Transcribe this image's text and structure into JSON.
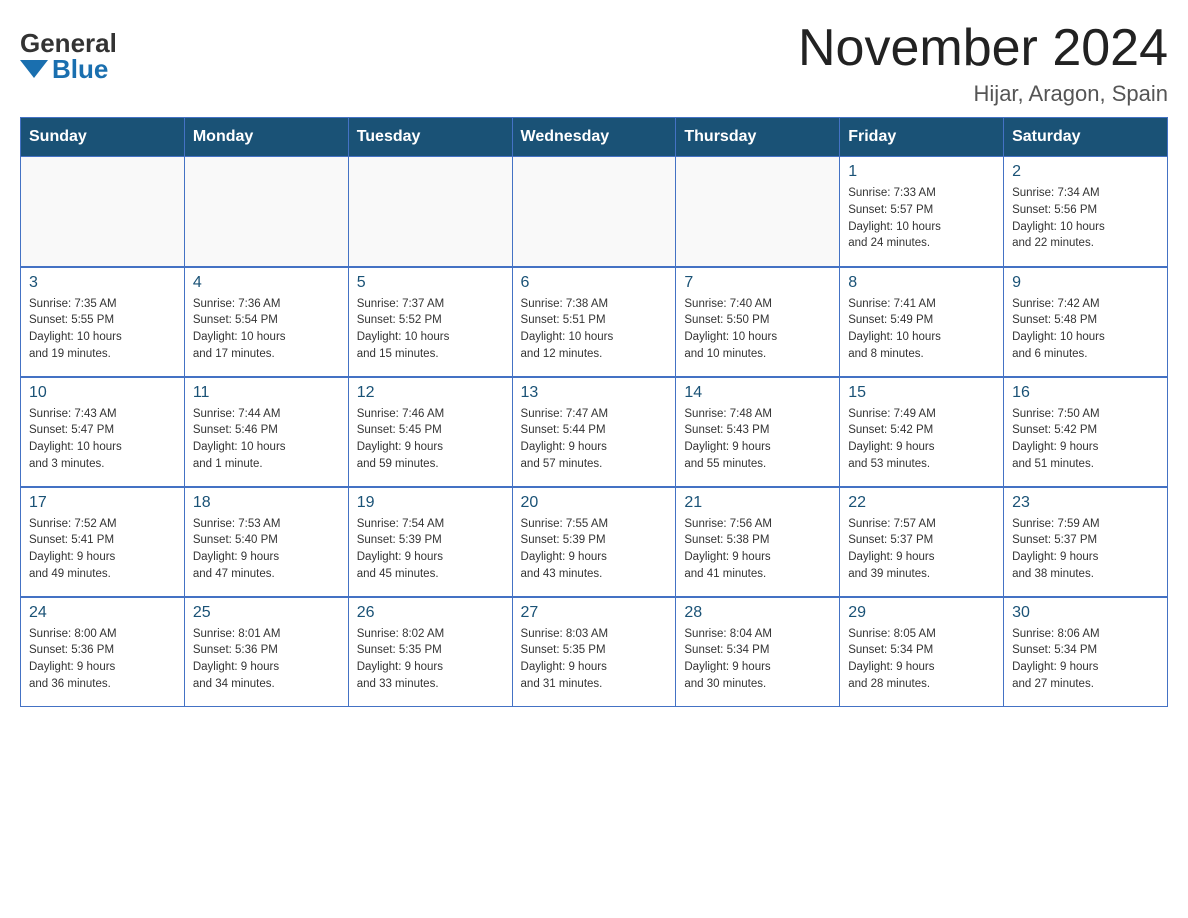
{
  "header": {
    "logo_general": "General",
    "logo_blue": "Blue",
    "month_year": "November 2024",
    "location": "Hijar, Aragon, Spain"
  },
  "weekdays": [
    "Sunday",
    "Monday",
    "Tuesday",
    "Wednesday",
    "Thursday",
    "Friday",
    "Saturday"
  ],
  "weeks": [
    [
      {
        "day": "",
        "info": ""
      },
      {
        "day": "",
        "info": ""
      },
      {
        "day": "",
        "info": ""
      },
      {
        "day": "",
        "info": ""
      },
      {
        "day": "",
        "info": ""
      },
      {
        "day": "1",
        "info": "Sunrise: 7:33 AM\nSunset: 5:57 PM\nDaylight: 10 hours\nand 24 minutes."
      },
      {
        "day": "2",
        "info": "Sunrise: 7:34 AM\nSunset: 5:56 PM\nDaylight: 10 hours\nand 22 minutes."
      }
    ],
    [
      {
        "day": "3",
        "info": "Sunrise: 7:35 AM\nSunset: 5:55 PM\nDaylight: 10 hours\nand 19 minutes."
      },
      {
        "day": "4",
        "info": "Sunrise: 7:36 AM\nSunset: 5:54 PM\nDaylight: 10 hours\nand 17 minutes."
      },
      {
        "day": "5",
        "info": "Sunrise: 7:37 AM\nSunset: 5:52 PM\nDaylight: 10 hours\nand 15 minutes."
      },
      {
        "day": "6",
        "info": "Sunrise: 7:38 AM\nSunset: 5:51 PM\nDaylight: 10 hours\nand 12 minutes."
      },
      {
        "day": "7",
        "info": "Sunrise: 7:40 AM\nSunset: 5:50 PM\nDaylight: 10 hours\nand 10 minutes."
      },
      {
        "day": "8",
        "info": "Sunrise: 7:41 AM\nSunset: 5:49 PM\nDaylight: 10 hours\nand 8 minutes."
      },
      {
        "day": "9",
        "info": "Sunrise: 7:42 AM\nSunset: 5:48 PM\nDaylight: 10 hours\nand 6 minutes."
      }
    ],
    [
      {
        "day": "10",
        "info": "Sunrise: 7:43 AM\nSunset: 5:47 PM\nDaylight: 10 hours\nand 3 minutes."
      },
      {
        "day": "11",
        "info": "Sunrise: 7:44 AM\nSunset: 5:46 PM\nDaylight: 10 hours\nand 1 minute."
      },
      {
        "day": "12",
        "info": "Sunrise: 7:46 AM\nSunset: 5:45 PM\nDaylight: 9 hours\nand 59 minutes."
      },
      {
        "day": "13",
        "info": "Sunrise: 7:47 AM\nSunset: 5:44 PM\nDaylight: 9 hours\nand 57 minutes."
      },
      {
        "day": "14",
        "info": "Sunrise: 7:48 AM\nSunset: 5:43 PM\nDaylight: 9 hours\nand 55 minutes."
      },
      {
        "day": "15",
        "info": "Sunrise: 7:49 AM\nSunset: 5:42 PM\nDaylight: 9 hours\nand 53 minutes."
      },
      {
        "day": "16",
        "info": "Sunrise: 7:50 AM\nSunset: 5:42 PM\nDaylight: 9 hours\nand 51 minutes."
      }
    ],
    [
      {
        "day": "17",
        "info": "Sunrise: 7:52 AM\nSunset: 5:41 PM\nDaylight: 9 hours\nand 49 minutes."
      },
      {
        "day": "18",
        "info": "Sunrise: 7:53 AM\nSunset: 5:40 PM\nDaylight: 9 hours\nand 47 minutes."
      },
      {
        "day": "19",
        "info": "Sunrise: 7:54 AM\nSunset: 5:39 PM\nDaylight: 9 hours\nand 45 minutes."
      },
      {
        "day": "20",
        "info": "Sunrise: 7:55 AM\nSunset: 5:39 PM\nDaylight: 9 hours\nand 43 minutes."
      },
      {
        "day": "21",
        "info": "Sunrise: 7:56 AM\nSunset: 5:38 PM\nDaylight: 9 hours\nand 41 minutes."
      },
      {
        "day": "22",
        "info": "Sunrise: 7:57 AM\nSunset: 5:37 PM\nDaylight: 9 hours\nand 39 minutes."
      },
      {
        "day": "23",
        "info": "Sunrise: 7:59 AM\nSunset: 5:37 PM\nDaylight: 9 hours\nand 38 minutes."
      }
    ],
    [
      {
        "day": "24",
        "info": "Sunrise: 8:00 AM\nSunset: 5:36 PM\nDaylight: 9 hours\nand 36 minutes."
      },
      {
        "day": "25",
        "info": "Sunrise: 8:01 AM\nSunset: 5:36 PM\nDaylight: 9 hours\nand 34 minutes."
      },
      {
        "day": "26",
        "info": "Sunrise: 8:02 AM\nSunset: 5:35 PM\nDaylight: 9 hours\nand 33 minutes."
      },
      {
        "day": "27",
        "info": "Sunrise: 8:03 AM\nSunset: 5:35 PM\nDaylight: 9 hours\nand 31 minutes."
      },
      {
        "day": "28",
        "info": "Sunrise: 8:04 AM\nSunset: 5:34 PM\nDaylight: 9 hours\nand 30 minutes."
      },
      {
        "day": "29",
        "info": "Sunrise: 8:05 AM\nSunset: 5:34 PM\nDaylight: 9 hours\nand 28 minutes."
      },
      {
        "day": "30",
        "info": "Sunrise: 8:06 AM\nSunset: 5:34 PM\nDaylight: 9 hours\nand 27 minutes."
      }
    ]
  ]
}
